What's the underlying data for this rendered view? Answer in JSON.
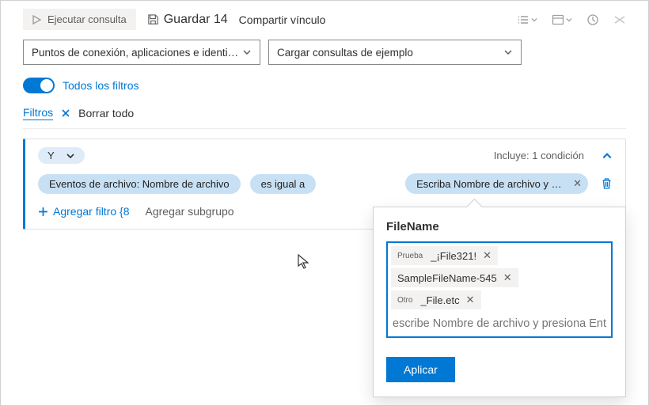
{
  "toolbar": {
    "run_label": "Ejecutar consulta",
    "save_label": "Guardar 14",
    "share_label": "Compartir vínculo"
  },
  "dropdowns": {
    "scope": "Puntos de conexión, aplicaciones e identidades: actividad…",
    "load_samples": "Cargar consultas de ejemplo"
  },
  "toggle_label": "Todos los filtros",
  "strip": {
    "filters_label": "Filtros",
    "clear_all": "Borrar todo"
  },
  "group": {
    "operator_label": "Y",
    "includes_text": "Incluye: 1 condición",
    "condition": {
      "field": "Eventos de archivo: Nombre de archivo",
      "op": "es igual a",
      "value_placeholder": "Escriba Nombre de archivo y presione…"
    },
    "add_filter": "Agregar filtro {8",
    "add_subgroup": "Agregar subgrupo"
  },
  "popover": {
    "title": "FileName",
    "chips": [
      {
        "prefix": "Prueba",
        "main": "_¡File321!"
      },
      {
        "prefix": "",
        "main": "SampleFileName-545"
      },
      {
        "prefix": "Otro",
        "main": "_File.etc"
      }
    ],
    "input_placeholder": "escribe Nombre de archivo y presiona Entrar",
    "apply_label": "Aplicar"
  }
}
